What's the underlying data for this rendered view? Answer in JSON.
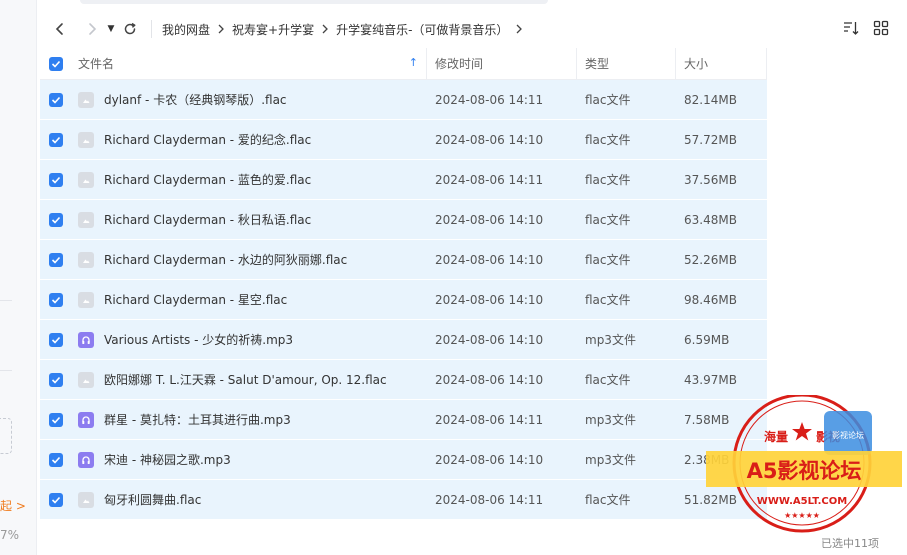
{
  "sidebar": {
    "fragment_1": "起 >",
    "fragment_2": "7%"
  },
  "toolbar": {
    "breadcrumb": [
      "我的网盘",
      "祝寿宴+升学宴",
      "升学宴纯音乐-（可做背景音乐）"
    ]
  },
  "table": {
    "headers": {
      "name": "文件名",
      "modified": "修改时间",
      "type": "类型",
      "size": "大小"
    },
    "rows": [
      {
        "name": "dylanf - 卡农（经典钢琴版）.flac",
        "modified": "2024-08-06 14:11",
        "type": "flac文件",
        "size": "82.14MB",
        "icon": "flac"
      },
      {
        "name": "Richard Clayderman - 爱的纪念.flac",
        "modified": "2024-08-06 14:10",
        "type": "flac文件",
        "size": "57.72MB",
        "icon": "flac"
      },
      {
        "name": "Richard Clayderman - 蓝色的爱.flac",
        "modified": "2024-08-06 14:11",
        "type": "flac文件",
        "size": "37.56MB",
        "icon": "flac"
      },
      {
        "name": "Richard Clayderman - 秋日私语.flac",
        "modified": "2024-08-06 14:10",
        "type": "flac文件",
        "size": "63.48MB",
        "icon": "flac"
      },
      {
        "name": "Richard Clayderman - 水边的阿狄丽娜.flac",
        "modified": "2024-08-06 14:10",
        "type": "flac文件",
        "size": "52.26MB",
        "icon": "flac"
      },
      {
        "name": "Richard Clayderman - 星空.flac",
        "modified": "2024-08-06 14:10",
        "type": "flac文件",
        "size": "98.46MB",
        "icon": "flac"
      },
      {
        "name": "Various Artists - 少女的祈祷.mp3",
        "modified": "2024-08-06 14:10",
        "type": "mp3文件",
        "size": "6.59MB",
        "icon": "mp3"
      },
      {
        "name": "欧阳娜娜 T. L.江天霖 - Salut D'amour, Op. 12.flac",
        "modified": "2024-08-06 14:10",
        "type": "flac文件",
        "size": "43.97MB",
        "icon": "flac"
      },
      {
        "name": "群星 - 莫扎特：土耳其进行曲.mp3",
        "modified": "2024-08-06 14:11",
        "type": "mp3文件",
        "size": "7.58MB",
        "icon": "mp3"
      },
      {
        "name": "宋迪 - 神秘园之歌.mp3",
        "modified": "2024-08-06 14:10",
        "type": "mp3文件",
        "size": "2.38MB",
        "icon": "mp3"
      },
      {
        "name": "匈牙利圆舞曲.flac",
        "modified": "2024-08-06 14:11",
        "type": "flac文件",
        "size": "51.82MB",
        "icon": "flac"
      }
    ]
  },
  "watermark": {
    "line_top_left": "海量",
    "line_top_right": "影视",
    "title": "A5影视论坛",
    "url": "WWW.A5LT.COM",
    "badge": "影视论坛"
  },
  "status": {
    "selected": "已选中11项"
  },
  "colors": {
    "accent": "#2f7ff0",
    "row_selected": "#e9f4fd",
    "mp3_icon": "#8c7cf0",
    "stamp_red": "#d91e18"
  }
}
